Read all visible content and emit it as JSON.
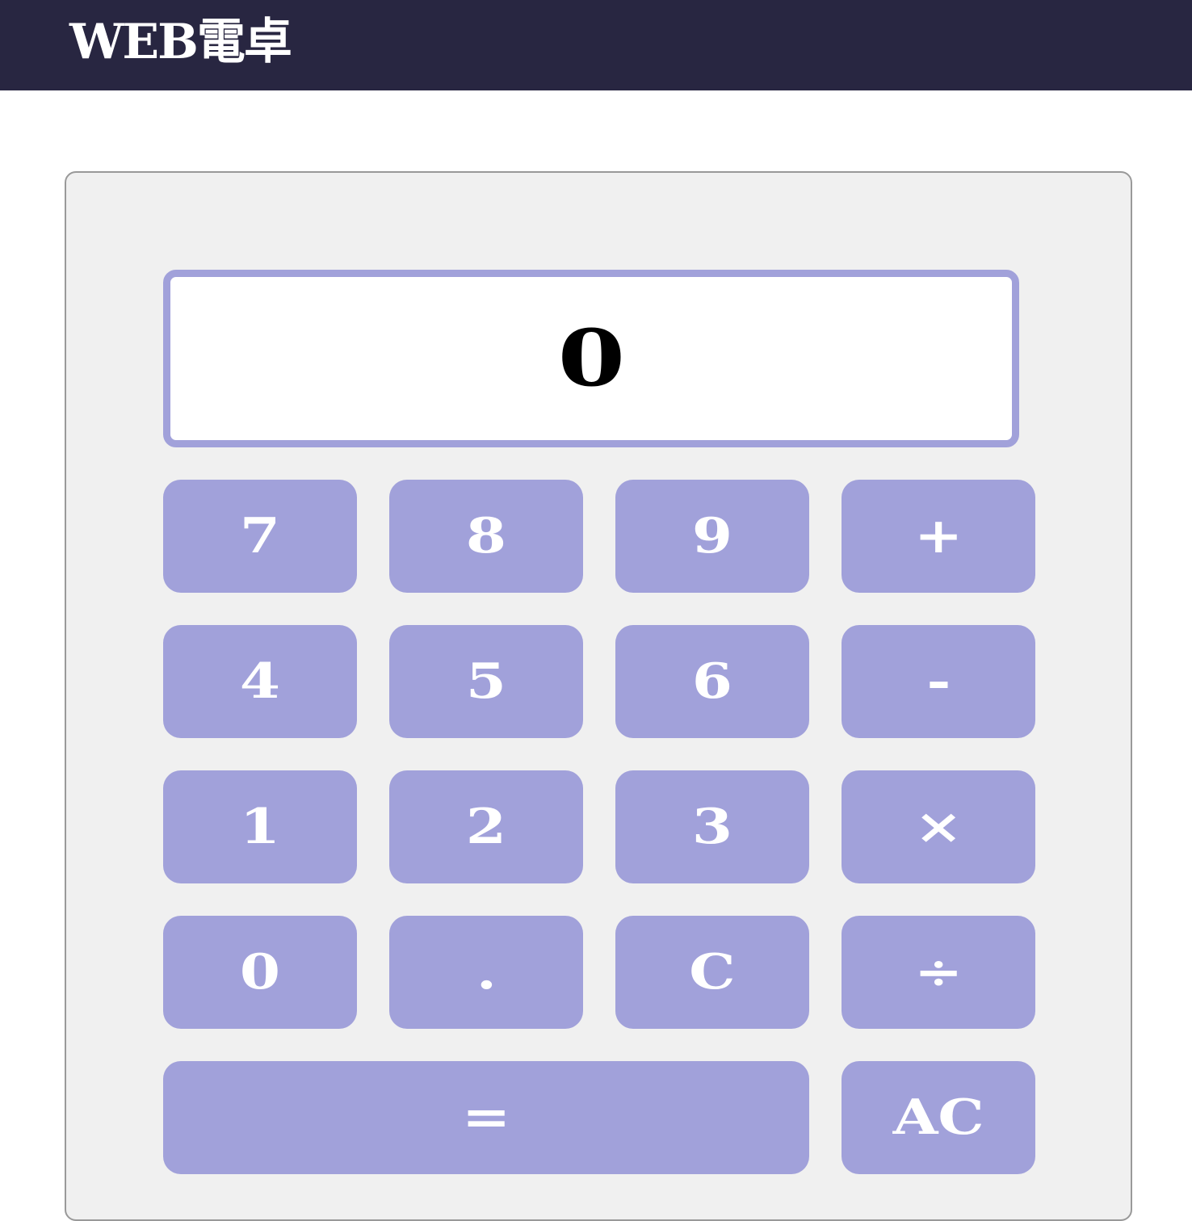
{
  "header": {
    "title": "WEB電卓"
  },
  "display": {
    "value": "0"
  },
  "keys": {
    "k7": "7",
    "k8": "8",
    "k9": "9",
    "plus": "+",
    "k4": "4",
    "k5": "5",
    "k6": "6",
    "minus": "-",
    "k1": "1",
    "k2": "2",
    "k3": "3",
    "multiply": "×",
    "k0": "0",
    "dot": ".",
    "clear": "C",
    "divide": "÷",
    "equals": "=",
    "all_clear": "AC"
  },
  "colors": {
    "header_bg": "#282641",
    "key_bg": "#a1a1da",
    "panel_bg": "#f0f0f0",
    "display_border": "#a1a1da"
  }
}
